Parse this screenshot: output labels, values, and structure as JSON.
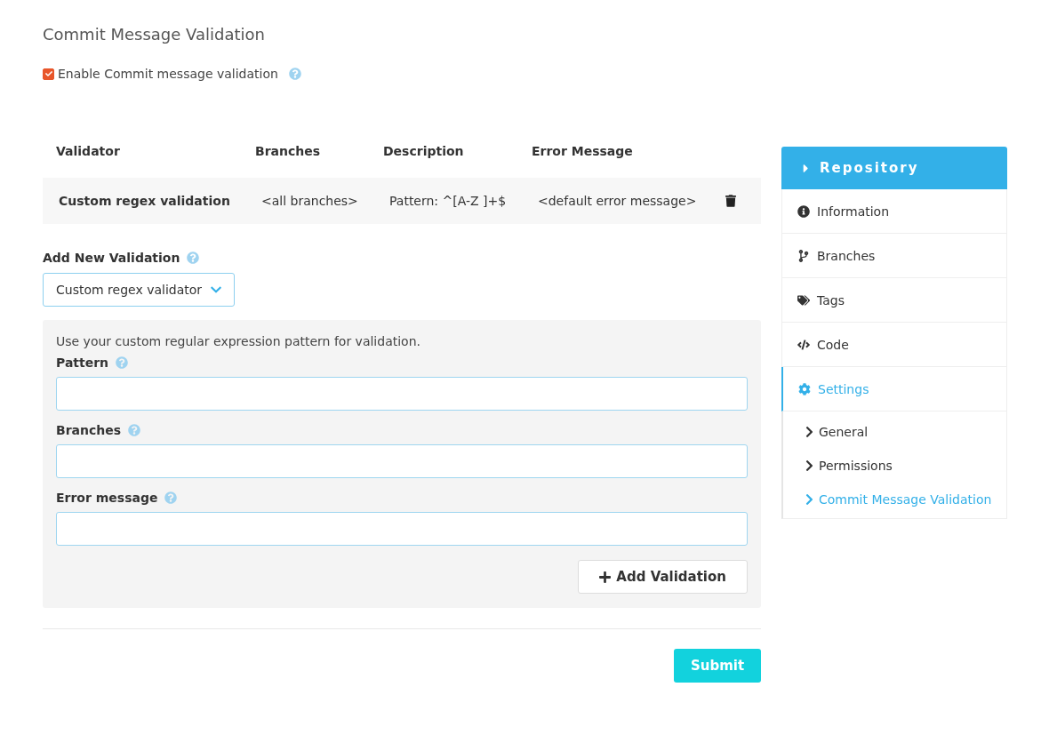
{
  "title": "Commit Message Validation",
  "enable": {
    "label": "Enable Commit message validation",
    "checked": true
  },
  "table": {
    "columns": [
      "Validator",
      "Branches",
      "Description",
      "Error Message"
    ],
    "rows": [
      {
        "cells": [
          "Custom regex validation",
          "<all branches>",
          "Pattern: ^[A-Z ]+$",
          "<default error message>"
        ]
      }
    ]
  },
  "add": {
    "label": "Add New Validation",
    "select": "Custom regex validator",
    "hint": "Use your custom regular expression pattern for validation.",
    "fields": [
      {
        "label": "Pattern"
      },
      {
        "label": "Branches"
      },
      {
        "label": "Error message"
      }
    ],
    "button": "Add Validation"
  },
  "submit": "Submit",
  "sidebar": {
    "header": "Repository",
    "items": [
      {
        "kind": "info",
        "label": "Information",
        "selected": false
      },
      {
        "kind": "branch",
        "label": "Branches",
        "selected": false
      },
      {
        "kind": "tags",
        "label": "Tags",
        "selected": false
      },
      {
        "kind": "code",
        "label": "Code",
        "selected": false
      },
      {
        "kind": "settings",
        "label": "Settings",
        "selected": true,
        "children": [
          {
            "label": "General",
            "selected": false
          },
          {
            "label": "Permissions",
            "selected": false
          },
          {
            "label": "Commit Message Validation",
            "selected": true
          }
        ]
      }
    ]
  }
}
